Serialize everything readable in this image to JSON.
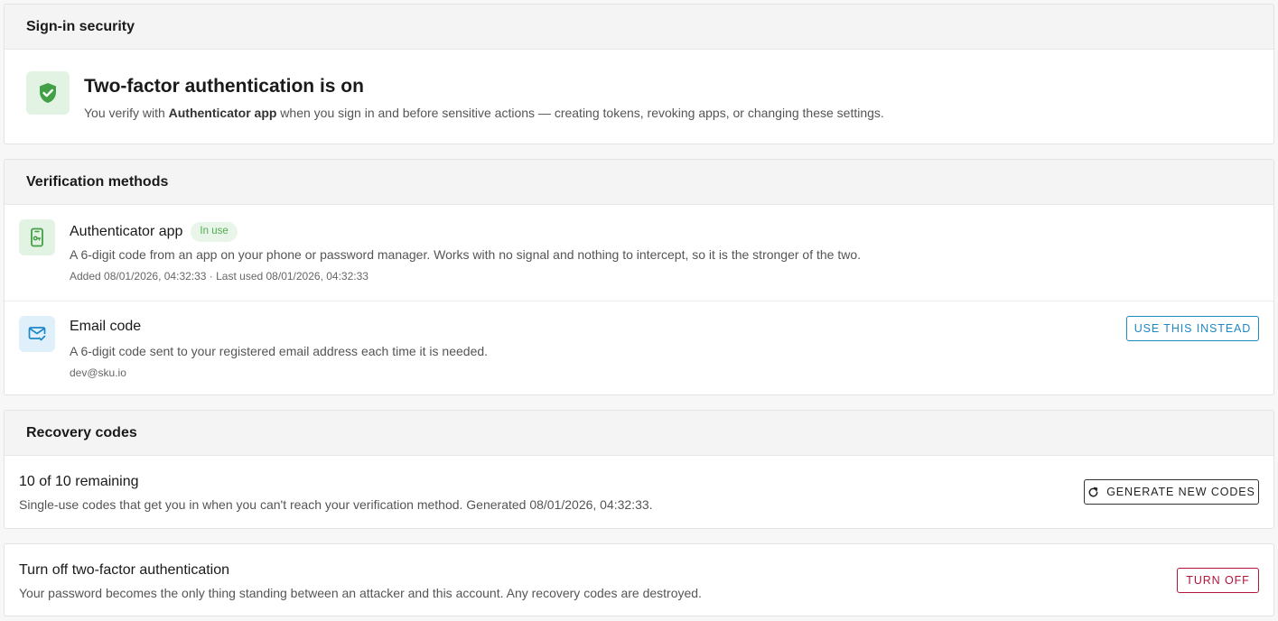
{
  "sign_in_security": {
    "header": "Sign-in security",
    "status_title": "Two-factor authentication is on",
    "desc_prefix": "You verify with ",
    "desc_method": "Authenticator app",
    "desc_suffix": " when you sign in and before sensitive actions — creating tokens, revoking apps, or changing these settings.",
    "icon": "shield-check-icon",
    "accent": "#43a047"
  },
  "verification_methods": {
    "header": "Verification methods",
    "authenticator": {
      "name": "Authenticator app",
      "badge": "In use",
      "description": "A 6-digit code from an app on your phone or password manager. Works with no signal and nothing to intercept, so it is the stronger of the two.",
      "meta": "Added 08/01/2026, 04:32:33 · Last used 08/01/2026, 04:32:33",
      "icon": "phone-key-icon"
    },
    "email": {
      "name": "Email code",
      "description": "A 6-digit code sent to your registered email address each time it is needed.",
      "address": "dev@sku.io",
      "button": "USE THIS INSTEAD",
      "icon": "mail-check-icon",
      "accent": "#1e88c7"
    }
  },
  "recovery_codes": {
    "header": "Recovery codes",
    "remaining": "10 of 10 remaining",
    "description": "Single-use codes that get you in when you can't reach your verification method. Generated 08/01/2026, 04:32:33.",
    "button": "GENERATE NEW CODES",
    "button_icon": "refresh-icon"
  },
  "turn_off": {
    "title": "Turn off two-factor authentication",
    "description": "Your password becomes the only thing standing between an attacker and this account. Any recovery codes are destroyed.",
    "button": "TURN OFF",
    "accent": "#b0163a"
  }
}
